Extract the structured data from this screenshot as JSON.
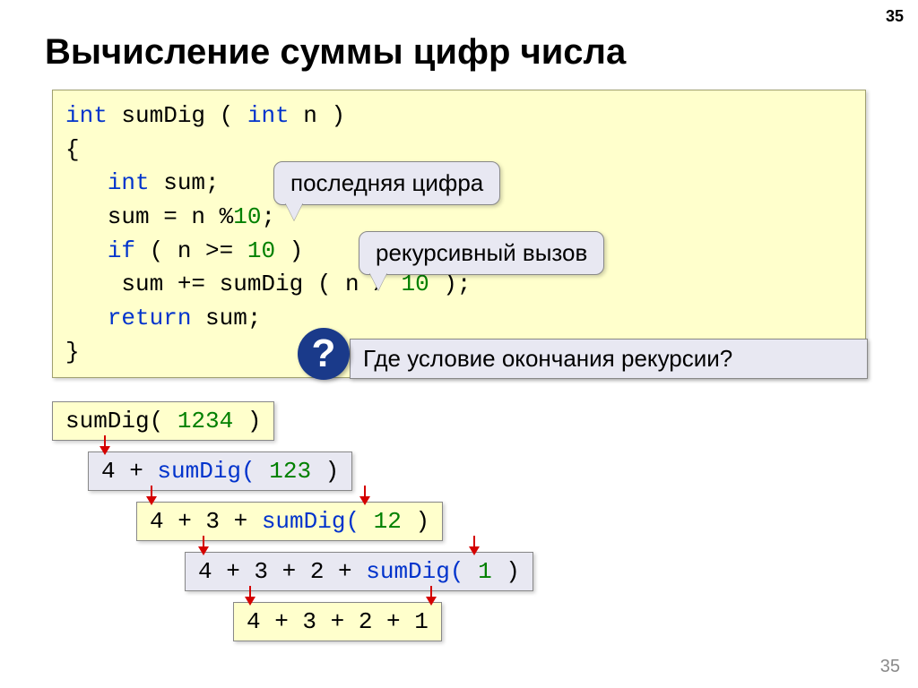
{
  "page_number": "35",
  "title": "Вычисление суммы цифр числа",
  "code": {
    "l1a": "int",
    "l1b": " sumDig ( ",
    "l1c": "int",
    "l1d": " n )",
    "l2": "{",
    "l3a": "   ",
    "l3b": "int",
    "l3c": " sum;",
    "l4a": "   sum = n %",
    "l4b": "10",
    "l4c": ";",
    "l5a": "   ",
    "l5b": "if",
    "l5c": " ( n >= ",
    "l5d": "10",
    "l5e": " )",
    "l6a": "    sum += sumDig ( n / ",
    "l6b": "10",
    "l6c": " );",
    "l7a": "   ",
    "l7b": "return",
    "l7c": " sum;",
    "l8": "}"
  },
  "callouts": {
    "last_digit": "последняя цифра",
    "recursive_call": "рекурсивный вызов",
    "question": "Где условие окончания рекурсии?",
    "q_mark": "?"
  },
  "steps": {
    "s1a": "sumDig( ",
    "s1b": "1234",
    "s1c": " )",
    "s2a": "4 + ",
    "s2b": "sumDig( ",
    "s2c": "123",
    "s2d": " )",
    "s3a": "4 + 3 + ",
    "s3b": "sumDig( ",
    "s3c": "12",
    "s3d": " )",
    "s4a": "4 + 3 + 2 + ",
    "s4b": "sumDig( ",
    "s4c": "1",
    "s4d": " )",
    "s5": "4 + 3 + 2 + 1"
  }
}
